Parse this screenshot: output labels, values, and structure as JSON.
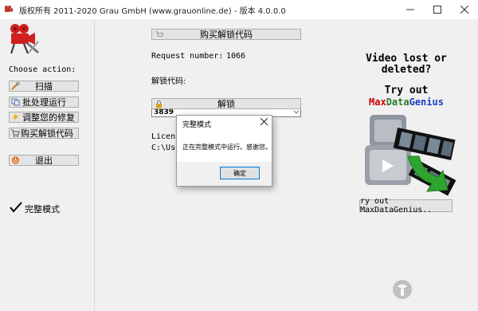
{
  "window": {
    "title": "版权所有 2011-2020 Grau GmbH (www.grauonline.de) - 版本 4.0.0.0",
    "minimize_icon": "minimize-icon",
    "maximize_icon": "maximize-icon",
    "close_icon": "close-icon"
  },
  "sidebar": {
    "choose_action": "Choose action:",
    "buttons": [
      {
        "label": "扫描",
        "icon": "wrench-icon"
      },
      {
        "label": "批处理运行",
        "icon": "copy-icon"
      },
      {
        "label": "调整您的修复",
        "icon": "lightning-icon"
      },
      {
        "label": "购买解锁代码",
        "icon": "cart-icon"
      },
      {
        "label": "退出",
        "icon": "power-icon"
      }
    ],
    "mode_label": "完整模式"
  },
  "main": {
    "buy_button": "购买解锁代码",
    "request_label": "Request number:",
    "request_value": "1066",
    "unlock_code_label": "解锁代码:",
    "unlock_code_value": "3839",
    "unlock_button": "解锁",
    "license_text_1": "Licens",
    "license_text_2": "C:\\Use"
  },
  "dialog": {
    "title": "完整模式",
    "message": "正在完整模式中运行。感谢您。",
    "ok_button": "确定",
    "close_icon": "close-icon"
  },
  "ad": {
    "line1": "Video lost or",
    "line2": "deleted?",
    "line3": "Try out",
    "brand_max": "Max",
    "brand_data": "Data",
    "brand_genius": "Genius",
    "try_button": "ry out MaxDataGenius.."
  },
  "colors": {
    "brand_max": "#cc0000",
    "brand_data": "#2a7a2a",
    "brand_genius": "#1a3fc4"
  }
}
